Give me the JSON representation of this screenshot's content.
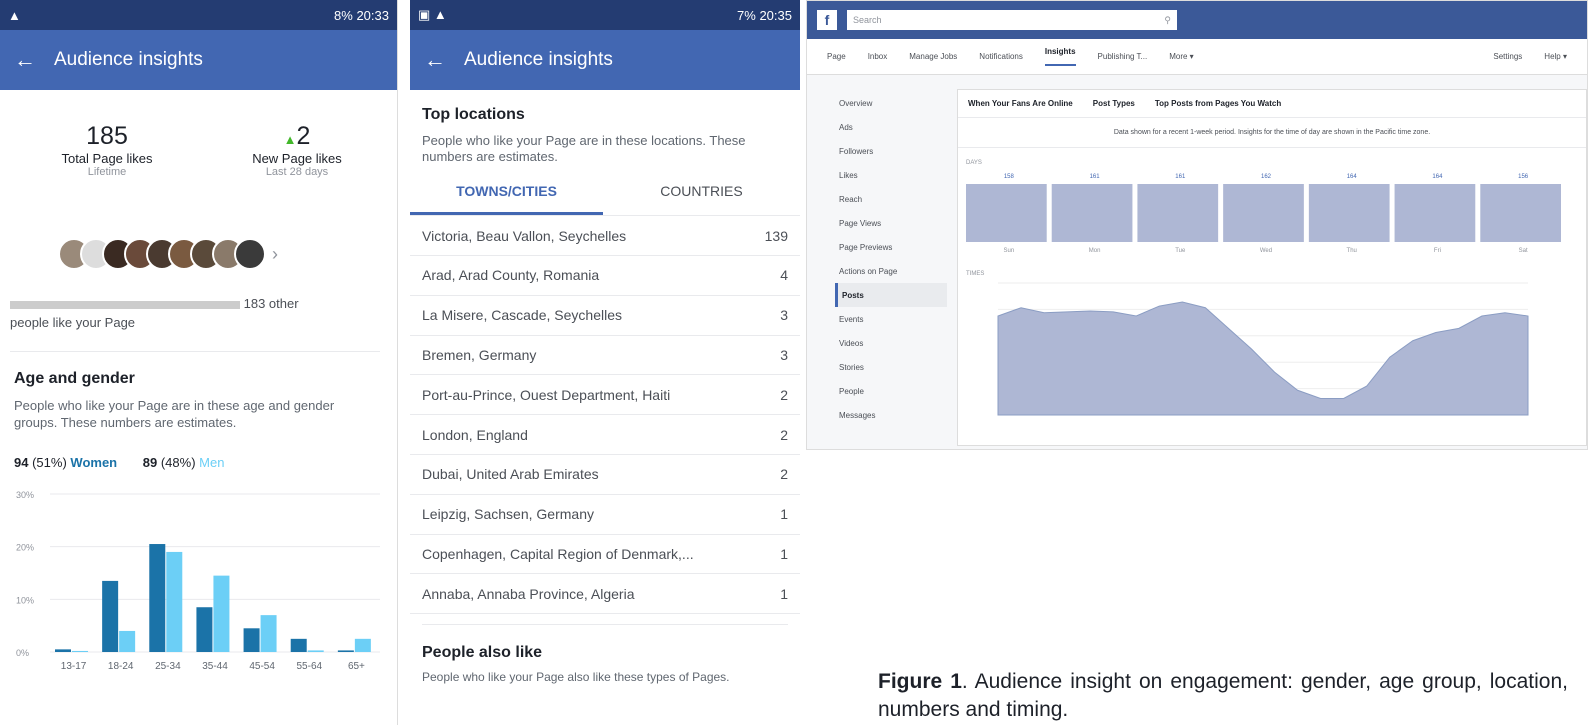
{
  "phone1": {
    "status_time": "20:33",
    "status_battery": "8%",
    "title": "Audience insights",
    "total_likes": "185",
    "total_likes_label": "Total Page likes",
    "total_likes_sub": "Lifetime",
    "new_likes": "2",
    "new_likes_label": "New Page likes",
    "new_likes_sub": "Last 28 days",
    "others_text": "183 other",
    "people_like": "people like your Page",
    "age_title": "Age and gender",
    "age_desc": "People who like your Page are in these age and gender groups. These numbers are estimates.",
    "women_count": "94",
    "women_pct": "(51%)",
    "women_label": "Women",
    "men_count": "89",
    "men_pct": "(48%)",
    "men_label": "Men",
    "colors": {
      "women": "#1b73a8",
      "men": "#6ccff6",
      "header": "#4267b2",
      "status": "#243c72"
    }
  },
  "chart_data": [
    {
      "type": "bar",
      "categories": [
        "13-17",
        "18-24",
        "25-34",
        "35-44",
        "45-54",
        "55-64",
        "65+"
      ],
      "series": [
        {
          "name": "Women",
          "values": [
            0.5,
            13.5,
            20.5,
            8.5,
            4.5,
            2.5,
            0.3
          ]
        },
        {
          "name": "Men",
          "values": [
            0.2,
            4,
            19,
            14.5,
            7,
            0.3,
            2.5
          ]
        }
      ],
      "ylim": [
        0,
        30
      ],
      "yticks": [
        "0%",
        "10%",
        "20%",
        "30%"
      ]
    },
    {
      "type": "bar",
      "categories": [
        "Sun",
        "Mon",
        "Tue",
        "Wed",
        "Thu",
        "Fri",
        "Sat"
      ],
      "values": [
        158,
        161,
        161,
        162,
        164,
        164,
        156
      ],
      "ylabel": "DAYS"
    },
    {
      "type": "area",
      "ylabel": "TIMES",
      "x": [
        0,
        1,
        2,
        3,
        4,
        5,
        6,
        7,
        8,
        9,
        10,
        11,
        12,
        13,
        14,
        15,
        16,
        17,
        18,
        19,
        20,
        21,
        22,
        23
      ],
      "values": [
        120,
        130,
        124,
        125,
        126,
        125,
        120,
        132,
        137,
        130,
        105,
        80,
        52,
        30,
        20,
        20,
        35,
        70,
        90,
        100,
        105,
        120,
        124,
        120
      ],
      "ylim": [
        0,
        160
      ]
    }
  ],
  "phone2": {
    "status_time": "20:35",
    "status_battery": "7%",
    "title": "Audience insights",
    "section_title": "Top locations",
    "section_desc": "People who like your Page are in these locations. These numbers are estimates.",
    "tab_towns": "TOWNS/CITIES",
    "tab_countries": "COUNTRIES",
    "locations": [
      {
        "name": "Victoria, Beau Vallon, Seychelles",
        "count": "139"
      },
      {
        "name": "Arad, Arad County, Romania",
        "count": "4"
      },
      {
        "name": "La Misere, Cascade, Seychelles",
        "count": "3"
      },
      {
        "name": "Bremen, Germany",
        "count": "3"
      },
      {
        "name": "Port-au-Prince, Ouest Department, Haiti",
        "count": "2"
      },
      {
        "name": "London, England",
        "count": "2"
      },
      {
        "name": "Dubai, United Arab Emirates",
        "count": "2"
      },
      {
        "name": "Leipzig, Sachsen, Germany",
        "count": "1"
      },
      {
        "name": "Copenhagen, Capital Region of Denmark,...",
        "count": "1"
      },
      {
        "name": "Annaba, Annaba Province, Algeria",
        "count": "1"
      }
    ],
    "also_title": "People also like",
    "also_desc": "People who like your Page also like these types of Pages."
  },
  "fb": {
    "search_placeholder": "Search",
    "nav": [
      "Page",
      "Inbox",
      "Manage Jobs",
      "Notifications",
      "Insights",
      "Publishing T...",
      "More ▾"
    ],
    "nav_right": [
      "Settings",
      "Help ▾"
    ],
    "side": [
      "Overview",
      "Ads",
      "Followers",
      "Likes",
      "Reach",
      "Page Views",
      "Page Previews",
      "Actions on Page",
      "Posts",
      "Events",
      "Videos",
      "Stories",
      "People",
      "Messages"
    ],
    "tabs": [
      "When Your Fans Are Online",
      "Post Types",
      "Top Posts from Pages You Watch"
    ],
    "notice": "Data shown for a recent 1-week period. Insights for the time of day are shown in the Pacific time zone."
  },
  "caption": {
    "bold": "Figure 1",
    "text": ". Audience insight on engagement: gender, age group, location, numbers and timing."
  }
}
